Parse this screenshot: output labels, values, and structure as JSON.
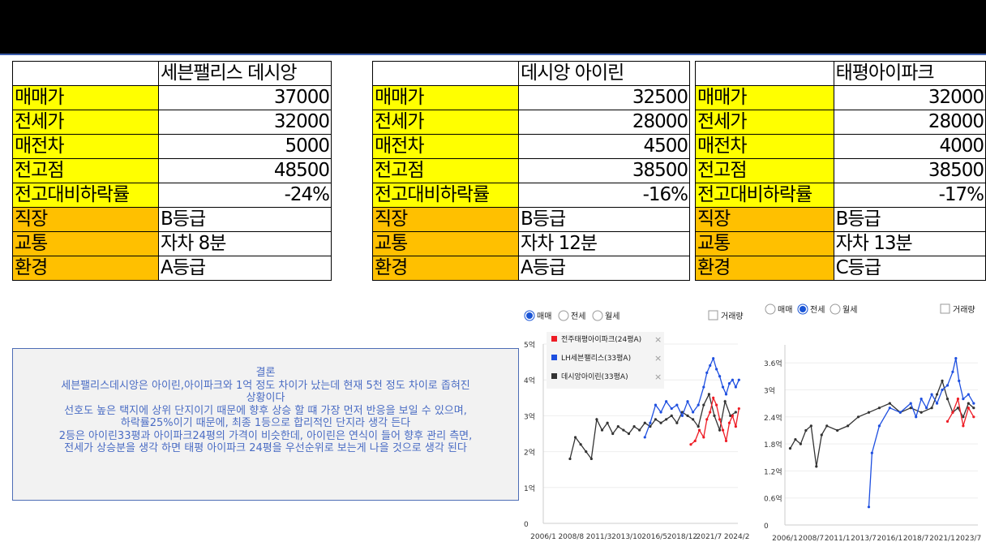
{
  "tables": [
    {
      "header": "세븐팰리스 데시앙",
      "rows": [
        {
          "label": "매매가",
          "value": "37000",
          "color": "#ffff00"
        },
        {
          "label": "전세가",
          "value": "32000",
          "color": "#ffff00"
        },
        {
          "label": "매전차",
          "value": "5000",
          "color": "#ffff00"
        },
        {
          "label": "전고점",
          "value": "48500",
          "color": "#ffff00"
        },
        {
          "label": "전고대비하락률",
          "value": "-24%",
          "color": "#ffff00"
        },
        {
          "label": "직장",
          "value": "B등급",
          "color": "#ffc000"
        },
        {
          "label": "교통",
          "value": "자차 8분",
          "color": "#ffc000"
        },
        {
          "label": "환경",
          "value": "A등급",
          "color": "#ffc000"
        }
      ]
    },
    {
      "header": "데시앙 아이린",
      "rows": [
        {
          "label": "매매가",
          "value": "32500",
          "color": "#ffff00"
        },
        {
          "label": "전세가",
          "value": "28000",
          "color": "#ffff00"
        },
        {
          "label": "매전차",
          "value": "4500",
          "color": "#ffff00"
        },
        {
          "label": "전고점",
          "value": "38500",
          "color": "#ffff00"
        },
        {
          "label": "전고대비하락률",
          "value": "-16%",
          "color": "#ffff00"
        },
        {
          "label": "직장",
          "value": "B등급",
          "color": "#ffc000"
        },
        {
          "label": "교통",
          "value": "자차 12분",
          "color": "#ffc000"
        },
        {
          "label": "환경",
          "value": "A등급",
          "color": "#ffc000"
        }
      ]
    },
    {
      "header": "태평아이파크",
      "rows": [
        {
          "label": "매매가",
          "value": "32000",
          "color": "#ffff00"
        },
        {
          "label": "전세가",
          "value": "28000",
          "color": "#ffff00"
        },
        {
          "label": "매전차",
          "value": "4000",
          "color": "#ffff00"
        },
        {
          "label": "전고점",
          "value": "38500",
          "color": "#ffff00"
        },
        {
          "label": "전고대비하락률",
          "value": "-17%",
          "color": "#ffff00"
        },
        {
          "label": "직장",
          "value": "B등급",
          "color": "#ffc000"
        },
        {
          "label": "교통",
          "value": "자차 13분",
          "color": "#ffc000"
        },
        {
          "label": "환경",
          "value": "C등급",
          "color": "#ffc000"
        }
      ]
    }
  ],
  "conclusion": {
    "title": "결론",
    "lines": [
      "세븐팰리스데시앙은 아이린,아이파크와 1억 정도 차이가 났는데 현재 5천 정도 차이로 좁혀진",
      "상황이다",
      "선호도 높은 택지에 상위 단지이기 때문에 향후 상승 할 떄 가장 먼저 반응을 보일 수 있으며,",
      "하락률25%이기 때문에, 최종  1등으로 합리적인 단지라 생각 든다",
      "2등은 아이린33평과 아이파크24평의 가격이 비슷한데, 아이린은 연식이 들어 향후 관리 측면,",
      "전세가 상승분을 생각 하면 태평 아이파크 24평을 우선순위로 보는게 나을 것으로 생각 된다"
    ]
  },
  "chart_data": [
    {
      "type": "line",
      "radio_options": [
        "매매",
        "전세",
        "월세"
      ],
      "selected": "매매",
      "checkbox_label": "거래량",
      "legend": [
        "전주태평아이파크(24평A)",
        "LH세븐팰리스(33평A)",
        "데시앙아이린(33평A)"
      ],
      "x_ticks": [
        "2006/1",
        "2008/8",
        "2011/3",
        "2013/10",
        "2016/5",
        "2018/12",
        "2021/7",
        "2024/2"
      ],
      "y_ticks": [
        "0",
        "1억",
        "2억",
        "3억",
        "4억",
        "5억"
      ],
      "ylim": [
        0,
        5
      ],
      "colors": [
        "#ee1c25",
        "#1e4fe0",
        "#333333"
      ],
      "series": [
        {
          "name": "전주태평아이파크(24평A)",
          "x": [
            2019.8,
            2020.2,
            2020.6,
            2021.0,
            2021.3,
            2021.6,
            2021.9,
            2022.2,
            2022.5,
            2022.8,
            2023.1,
            2023.4,
            2023.7,
            2024.0,
            2024.3
          ],
          "values": [
            2.2,
            2.3,
            2.6,
            2.4,
            2.9,
            3.1,
            3.5,
            3.3,
            2.9,
            2.6,
            2.3,
            2.8,
            3.0,
            2.7,
            3.2
          ]
        },
        {
          "name": "LH세븐팰리스(33평A)",
          "x": [
            2015.5,
            2016.0,
            2016.5,
            2017.0,
            2017.5,
            2018.0,
            2018.5,
            2019.0,
            2019.5,
            2020.0,
            2020.5,
            2021.0,
            2021.3,
            2021.6,
            2021.9,
            2022.2,
            2022.5,
            2022.8,
            2023.1,
            2023.4,
            2023.7,
            2024.0,
            2024.3
          ],
          "values": [
            2.4,
            2.8,
            3.3,
            3.1,
            3.4,
            3.2,
            3.3,
            3.0,
            3.4,
            3.1,
            3.3,
            3.8,
            4.2,
            4.4,
            4.6,
            4.3,
            4.1,
            3.8,
            3.6,
            3.9,
            4.0,
            3.8,
            4.0
          ]
        },
        {
          "name": "데시앙아이린(33평A)",
          "x": [
            2008.5,
            2009.0,
            2009.5,
            2010.0,
            2010.5,
            2011.0,
            2011.5,
            2012.0,
            2012.5,
            2013.0,
            2013.5,
            2014.0,
            2014.5,
            2015.0,
            2015.5,
            2016.0,
            2016.5,
            2017.0,
            2017.5,
            2018.0,
            2018.5,
            2019.0,
            2019.5,
            2020.0,
            2020.5,
            2021.0,
            2021.5,
            2022.0,
            2022.5,
            2023.0,
            2023.5,
            2024.0
          ],
          "values": [
            1.8,
            2.4,
            2.2,
            2.0,
            1.8,
            2.9,
            2.6,
            2.8,
            2.5,
            2.7,
            2.6,
            2.5,
            2.7,
            2.6,
            2.8,
            2.7,
            2.9,
            2.8,
            2.9,
            3.0,
            2.8,
            3.1,
            3.0,
            2.9,
            2.7,
            3.3,
            3.6,
            3.0,
            2.6,
            3.4,
            3.0,
            3.1
          ]
        }
      ]
    },
    {
      "type": "line",
      "radio_options": [
        "매매",
        "전세",
        "월세"
      ],
      "selected": "전세",
      "checkbox_label": "거래량",
      "x_ticks": [
        "2006/1",
        "2008/7",
        "2011/1",
        "2013/7",
        "2016/1",
        "2018/7",
        "2021/1",
        "2023/7"
      ],
      "y_ticks": [
        "0",
        "0.6억",
        "1.2억",
        "1.8억",
        "2.4억",
        "3억",
        "3.6억"
      ],
      "ylim": [
        0,
        4.0
      ],
      "colors": [
        "#ee1c25",
        "#1e4fe0",
        "#333333"
      ],
      "series": [
        {
          "name": "",
          "x": [
            2021.5,
            2022.0,
            2022.5,
            2023.0,
            2023.5,
            2024.0
          ],
          "values": [
            2.3,
            2.5,
            2.8,
            2.2,
            2.6,
            2.4
          ]
        },
        {
          "name": "",
          "x": [
            2014.0,
            2014.3,
            2015.0,
            2016.0,
            2017.0,
            2018.0,
            2018.5,
            2019.0,
            2019.5,
            2020.0,
            2020.5,
            2021.0,
            2021.5,
            2022.0,
            2022.3,
            2022.6,
            2023.0,
            2023.5,
            2024.0
          ],
          "values": [
            0.4,
            1.6,
            2.2,
            2.6,
            2.5,
            2.7,
            2.4,
            2.8,
            2.6,
            2.9,
            2.7,
            3.0,
            3.1,
            3.4,
            3.7,
            3.2,
            2.8,
            2.9,
            2.7
          ]
        },
        {
          "name": "",
          "x": [
            2006.5,
            2007.0,
            2007.5,
            2008.0,
            2008.5,
            2009.0,
            2009.5,
            2010.0,
            2011.0,
            2012.0,
            2013.0,
            2014.0,
            2015.0,
            2016.0,
            2017.0,
            2018.0,
            2019.0,
            2020.0,
            2020.5,
            2021.0,
            2021.5,
            2022.0,
            2022.5,
            2023.0,
            2023.5,
            2024.0
          ],
          "values": [
            1.7,
            1.9,
            1.8,
            2.1,
            2.2,
            1.3,
            2.0,
            2.2,
            2.1,
            2.2,
            2.4,
            2.5,
            2.6,
            2.7,
            2.5,
            2.6,
            2.5,
            2.6,
            2.9,
            3.2,
            2.8,
            2.5,
            2.6,
            2.4,
            2.7,
            2.6
          ]
        }
      ]
    }
  ]
}
